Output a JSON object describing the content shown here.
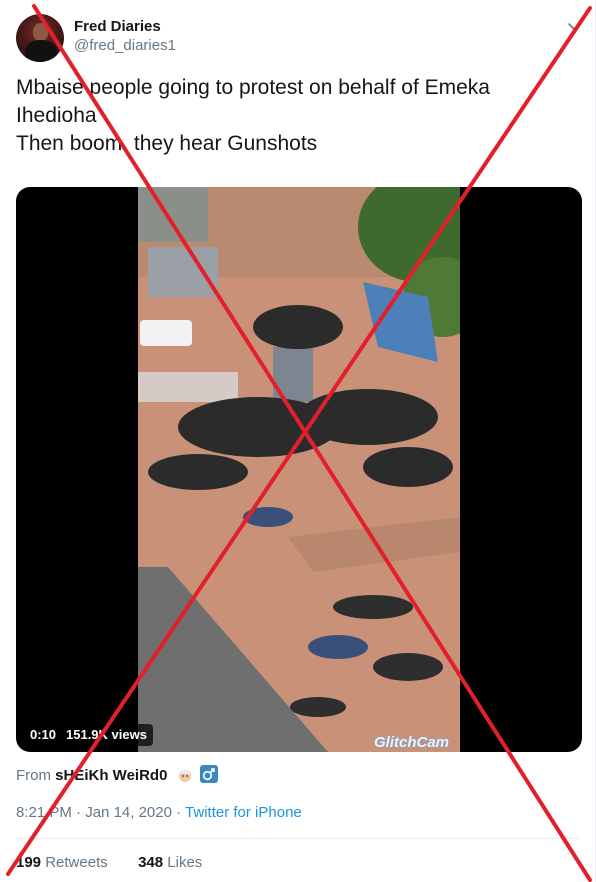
{
  "author": {
    "display_name": "Fred Diaries",
    "handle": "@fred_diaries1"
  },
  "tweet": {
    "line1": "Mbaise people going to protest on behalf of Emeka",
    "line2": "Ihedioha",
    "line3": "Then boom  they hear Gunshots"
  },
  "video": {
    "duration": "0:10",
    "views": "151.9K views",
    "watermark": "GlitchCam"
  },
  "attribution": {
    "prefix": "From",
    "user": "sHEiKh WeiRd0",
    "emojis": [
      "man-with-turban-emoji",
      "male-sign-emoji"
    ]
  },
  "meta": {
    "time": "8:21 PM",
    "separator1": " · ",
    "date": "Jan 14, 2020",
    "separator2": " · ",
    "source": "Twitter for iPhone"
  },
  "stats": {
    "retweets_count": "199",
    "retweets_label": "Retweets",
    "likes_count": "348",
    "likes_label": "Likes"
  },
  "colors": {
    "link": "#1b95e0",
    "secondary_text": "#657786",
    "overlay_x": "#e3202a"
  }
}
